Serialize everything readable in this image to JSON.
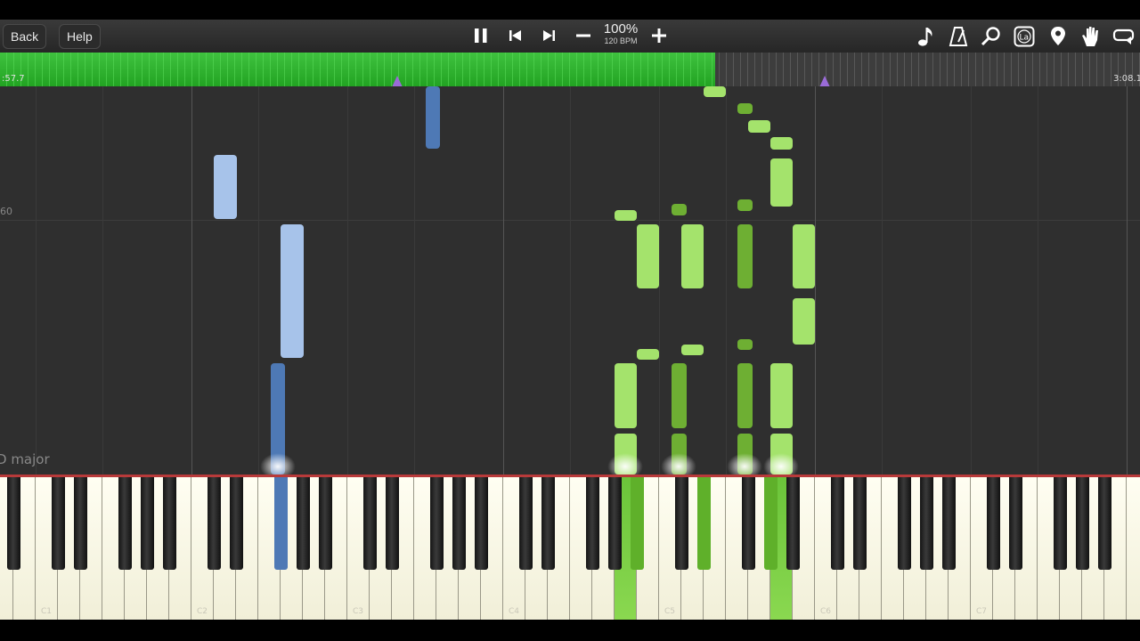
{
  "toolbar": {
    "back_label": "Back",
    "help_label": "Help",
    "speed_percent": "100%",
    "tempo": "120 BPM",
    "colors": {
      "accent_green": "#2fb52f",
      "marker_purple": "#9a6bd8",
      "left_hand_blue": "#4e79b5",
      "right_hand_green": "#9ee060"
    }
  },
  "timeline": {
    "left_time": ":57.7",
    "right_time": "3:08.1",
    "progress_fraction": 0.627,
    "loop_markers_seconds": [
      ":57.7 region start",
      "loop end"
    ]
  },
  "roll": {
    "measure_label": "60",
    "key_signature": "D major"
  },
  "keyboard": {
    "octave_labels": [
      "C1",
      "C2",
      "C3",
      "C4",
      "C5",
      "C6",
      "C7"
    ]
  }
}
